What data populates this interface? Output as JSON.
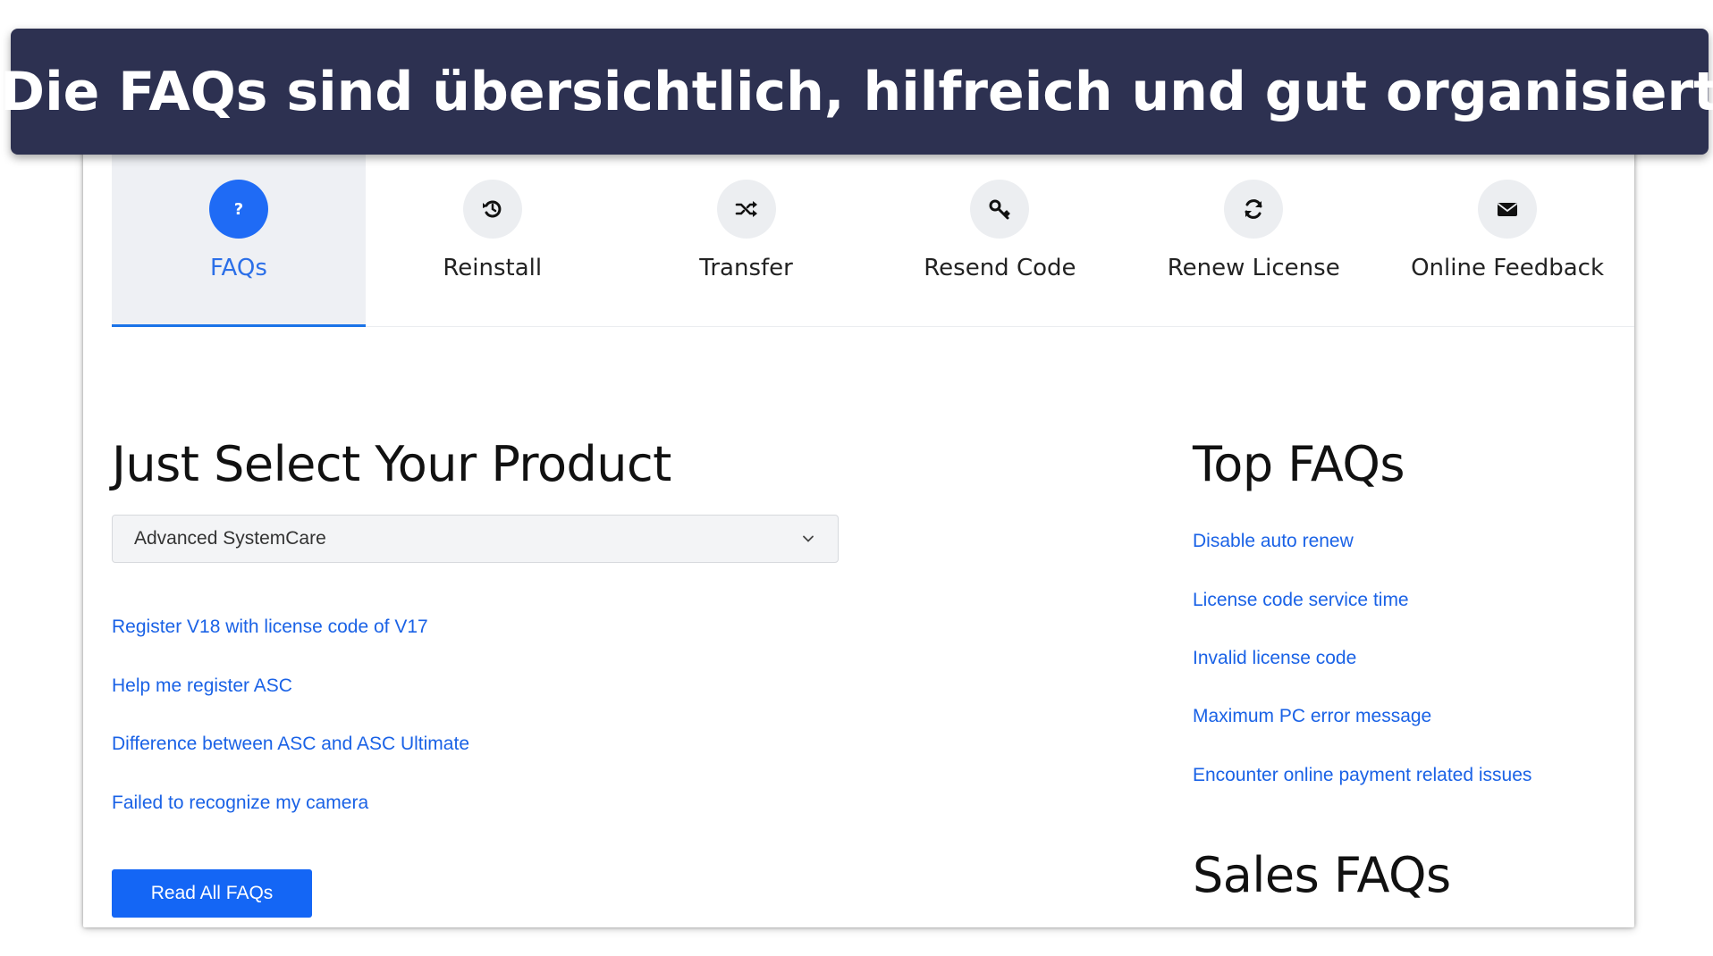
{
  "banner": {
    "title": "Die FAQs sind übersichtlich, hilfreich und gut organisiert"
  },
  "tabs": [
    {
      "label": "FAQs",
      "icon": "question-icon",
      "active": true
    },
    {
      "label": "Reinstall",
      "icon": "history-icon"
    },
    {
      "label": "Transfer",
      "icon": "shuffle-icon"
    },
    {
      "label": "Resend Code",
      "icon": "key-icon"
    },
    {
      "label": "Renew License",
      "icon": "refresh-icon"
    },
    {
      "label": "Online Feedback",
      "icon": "envelope-icon"
    }
  ],
  "product": {
    "heading": "Just Select Your Product",
    "selected": "Advanced SystemCare",
    "links": [
      "Register V18 with license code of V17",
      "Help me register ASC",
      "Difference between ASC and ASC Ultimate",
      "Failed to recognize my camera"
    ],
    "button": "Read All FAQs"
  },
  "top_faqs": {
    "heading": "Top FAQs",
    "links": [
      "Disable auto renew",
      "License code service time",
      "Invalid license code",
      "Maximum PC error message",
      "Encounter online payment related issues"
    ]
  },
  "sales_faqs": {
    "heading": "Sales FAQs"
  },
  "colors": {
    "accent": "#1f6bf5",
    "link": "#1a62e6",
    "banner": "#2d3151"
  }
}
